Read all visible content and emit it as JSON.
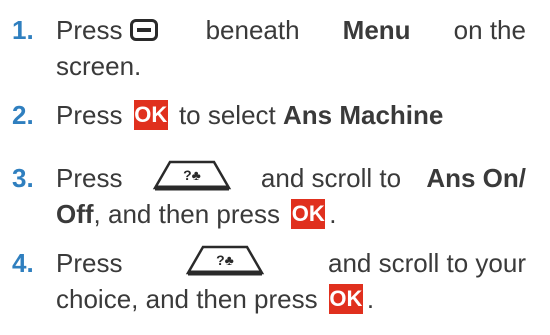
{
  "steps": [
    {
      "number": "1.",
      "press": "Press",
      "beneath": "beneath",
      "menu": "Menu",
      "on_the": "on the",
      "screen": "screen."
    },
    {
      "number": "2.",
      "press": "Press",
      "to_select": "to select",
      "ans_machine": "Ans Machine"
    },
    {
      "number": "3.",
      "press": "Press",
      "and_scroll_to": "and scroll to",
      "ans_on": "Ans On/",
      "off": "Off",
      "then_press": ", and then press",
      "period": "."
    },
    {
      "number": "4.",
      "press": "Press",
      "and_scroll": "and scroll to your",
      "choice": "choice, and then press",
      "period": "."
    }
  ],
  "icons": {
    "ok_label": "OK",
    "nav_label": "?♣",
    "accent_color": "#2f7fbf",
    "ok_color": "#e0301e"
  }
}
